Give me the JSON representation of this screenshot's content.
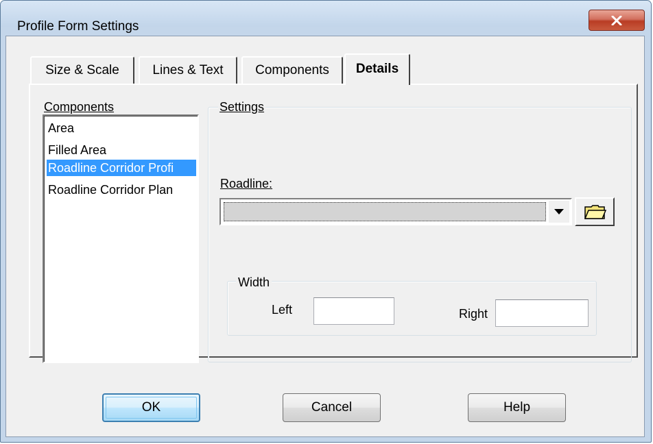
{
  "window": {
    "title": "Profile Form Settings"
  },
  "tabs": [
    {
      "label": "Size & Scale",
      "active": false
    },
    {
      "label": "Lines & Text",
      "active": false
    },
    {
      "label": "Components",
      "active": false
    },
    {
      "label": "Details",
      "active": true
    }
  ],
  "components": {
    "label": "Components",
    "items": [
      {
        "label": "Area",
        "selected": false
      },
      {
        "label": "Filled Area",
        "selected": false
      },
      {
        "label": "Roadline Corridor Profi",
        "selected": true
      },
      {
        "label": "Roadline Corridor Plan",
        "selected": false
      }
    ]
  },
  "settings": {
    "group_label": "Settings",
    "roadline_label": "Roadline:",
    "roadline_value": "",
    "width": {
      "group_label": "Width",
      "left_label": "Left",
      "left_value": "",
      "right_label": "Right",
      "right_value": ""
    }
  },
  "buttons": {
    "ok": "OK",
    "cancel": "Cancel",
    "help": "Help"
  },
  "icons": {
    "close": "close-icon",
    "dropdown": "chevron-down-icon",
    "browse": "folder-icon"
  },
  "colors": {
    "selection": "#3399ff",
    "close_button": "#c85a3e",
    "window_frame": "#c4d6ea",
    "dialog_bg": "#f0f0f0"
  }
}
